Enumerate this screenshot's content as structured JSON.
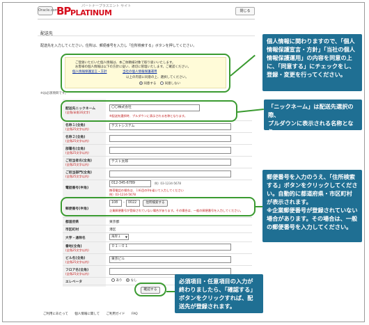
{
  "header": {
    "logo_badge": "Oracle.com",
    "logo_bp": "BP",
    "logo_platinum": "PLATINUM",
    "logo_subtitle": "パートナープラスエント サイト",
    "help_label": "閉じる"
  },
  "page_title": "配送先",
  "intro": "配送先を入力してください。住所は、郵便番号を入力し「住所検索する」ボタンを押してください。",
  "privacy": {
    "line1": "ご登録いただいた個人情報は、本ご依頼様対象で取り扱いいたします。",
    "line2": "お客様の個人情報は以下の方針に従い、適切に管理いたします。ご確認ください。",
    "link1": "個人情報保護宣言・方針",
    "link2": "当社の個人情報保護運用",
    "question": "以上の内容に同意の上、選択してください。",
    "agree_label": "同意する",
    "disagree_label": "同意しない"
  },
  "required_note": "※は必須項目です。",
  "form": {
    "nickname_label": "配送先ニックネーム",
    "nickname_sub": "(全角/半角16文字)",
    "nickname_value": "〇〇株式会社",
    "nickname_hint": "※配送先選択時、プルダウンに表示される名称となります。",
    "name1_label": "名称１(全角)",
    "name1_sub": "(全角25文字以内)",
    "name1_value": "テストシステム",
    "name2_label": "名称２(全角)",
    "name2_sub": "(全角25文字以内)",
    "dept_label": "部署名(全角)",
    "dept_sub": "(全角25文字以内)",
    "contact_label": "ご担当者名(全角)",
    "contact_sub": "(全角25文字以内)",
    "contact_value": "テスト太郎",
    "contact_dept_label": "ご担当部門(全角)",
    "contact_dept_sub": "(全角25文字以内)",
    "phone_label": "電話番号(半角)",
    "phone_value": "012-345-6789",
    "phone_example": "例）03-1234-5678",
    "phone_hint": "携帯電話の場合は、１桁目の0を省いて入力してください",
    "phone_hint2": "例）03-1234-5678",
    "zip_label": "郵便番号(半角)",
    "zip1": "108",
    "zip2": "0022",
    "zip_button": "住所検索する",
    "zip_hint": "企業郵便番号が登録されていない場合があります。その場合は、一般の郵便番号を入力してください。",
    "pref_label": "都道府県",
    "pref_value": "東京都",
    "city_label": "市区町村",
    "city_value": "港区",
    "area_label": "大字・通称名",
    "area_value": "海岸１",
    "street_label": "番地(全角)",
    "street_sub": "(全角25文字以内)",
    "street_value": "０１－０１",
    "building_label": "ビル名(全角)",
    "building_sub": "(全角25文字以内)",
    "building_value": "東京ビル",
    "floor_label": "フロア名(全角)",
    "floor_sub": "(全角25文字以内)",
    "elevator_label": "エレベータ",
    "elevator_yes": "あり",
    "elevator_no": "なし"
  },
  "confirm_button": "確認する",
  "footer": [
    "ご利用にあたって",
    "個人情報に関して",
    "ご利用ガイド",
    "FAQ"
  ],
  "callouts": {
    "privacy": "個人情報に関わりますので、「個人\n情報保護宣言・方針」「当社の個人\n情報保護運用」の内容を同意の上\nに、「同意する」にチェックをし、\n登録・変更を行ってください。",
    "nickname": "「ニックネーム」は配送先選択の際、\nプルダウンに表示される名称となり\nます。",
    "zip": "郵便番号を入力のうえ、「住所検索\nする」ボタンをクリックしてくださ\nい。自動的に都道府県・市区町村\nが表示されます。\n※企業郵便番号が登録されていない\n場合があります。その場合は、一般\nの郵便番号を入力してください。",
    "confirm": "必須項目・任意項目の入力が\n終わりましたら、「確認する」\nボタンをクリックすれば、配\n送先が登録されます。"
  },
  "colors": {
    "brand_red": "#d60f1e",
    "callout_bg": "#1f6f93",
    "highlight_green": "#3a9a30",
    "privacy_bg": "#fffbd8"
  }
}
